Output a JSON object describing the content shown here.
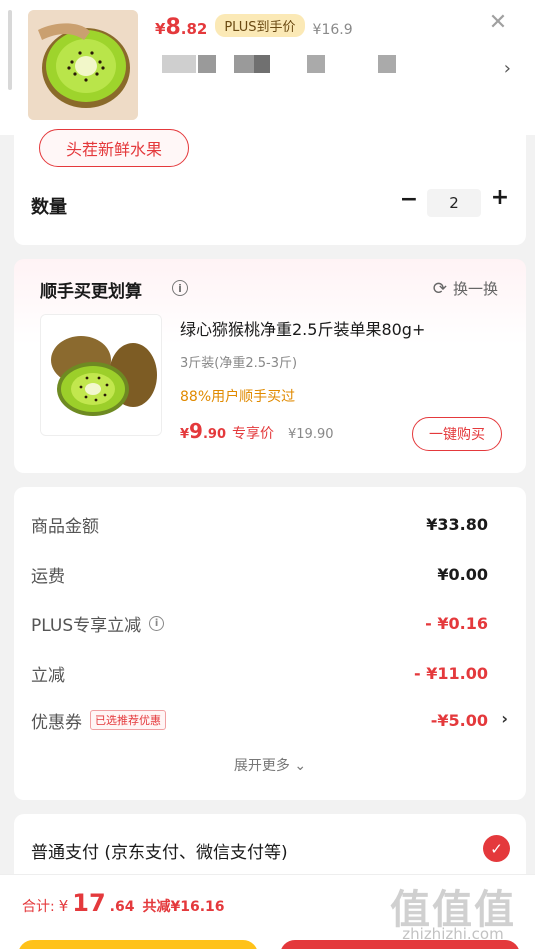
{
  "header": {
    "price_symbol": "¥",
    "price_int": "8",
    "price_dec": ".82",
    "plus_tag": "PLUS到手价",
    "original_price": "¥16.9",
    "close_icon": "close-icon",
    "more_icon": "chevron-right-icon"
  },
  "options": {
    "selected_tag": "头茬新鲜水果",
    "quantity_label": "数量",
    "quantity_value": "2",
    "minus": "−",
    "plus": "+"
  },
  "addon": {
    "title": "顺手买更划算",
    "swap_label": "换一换",
    "product_name": "绿心猕猴桃净重2.5斤装单果80g+",
    "spec": "3斤装(净重2.5-3斤)",
    "bought": "88%用户顺手买过",
    "price_symbol": "¥",
    "price_int": "9",
    "price_dec": ".90",
    "exclusive": "专享价",
    "original_price": "¥19.90",
    "buy_button": "一键购买"
  },
  "summary": {
    "goods_label": "商品金额",
    "goods_value": "¥33.80",
    "shipping_label": "运费",
    "shipping_value": "¥0.00",
    "plus_label": "PLUS专享立减",
    "plus_value": "- ¥0.16",
    "discount_label": "立减",
    "discount_value": "- ¥11.00",
    "coupon_label": "优惠券",
    "coupon_badge": "已选推荐优惠",
    "coupon_value": "-¥5.00",
    "expand_label": "展开更多"
  },
  "payment": {
    "method": "普通支付 (京东支付、微信支付等)",
    "check_icon": "check-icon"
  },
  "bottom": {
    "total_label": "合计:",
    "total_symbol": "¥",
    "total_int": "17",
    "total_dec": ".64",
    "total_saved": "共减¥16.16"
  },
  "watermark": {
    "glyph": "值值值",
    "url": "zhizhizhi.com"
  },
  "colors": {
    "accent_red": "#e4393c",
    "plus_gold": "#fbe9b6",
    "orange": "#e08a00",
    "yellow_button": "#ffc21a"
  }
}
